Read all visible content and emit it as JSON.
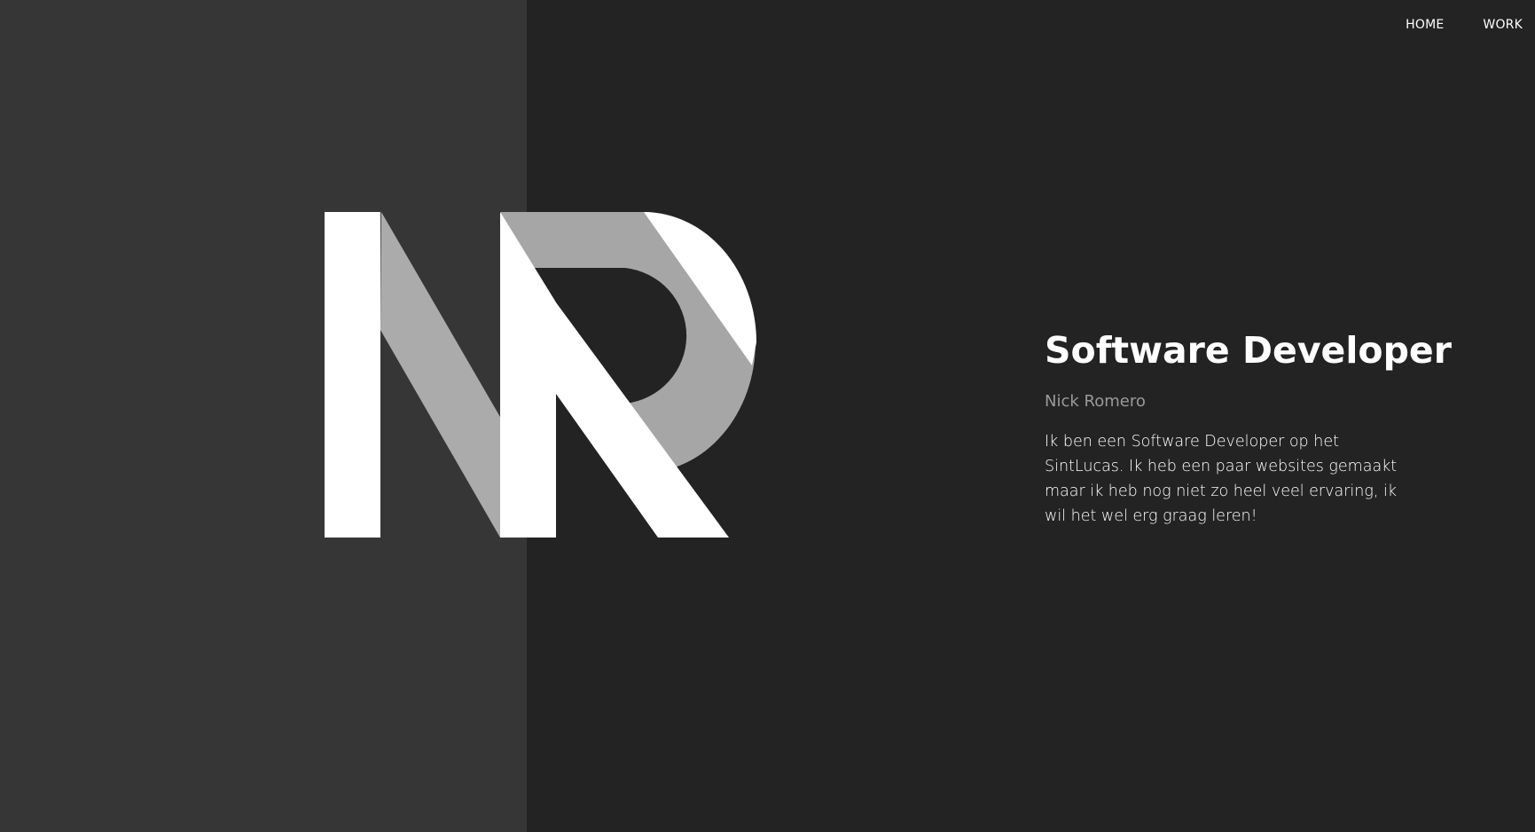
{
  "nav": {
    "items": [
      {
        "label": "HOME"
      },
      {
        "label": "WORK"
      }
    ]
  },
  "hero": {
    "title": "Software Developer",
    "name": "Nick Romero",
    "bio": "Ik ben een Software Developer op het SintLucas. Ik heb een paar websites gemaakt maar ik heb nog niet zo heel veel ervaring, ik wil het wel erg graag leren!"
  },
  "logo": {
    "icon": "nr-monogram-logo",
    "letters": "NR"
  },
  "colors": {
    "background": "#232323",
    "left_panel": "#363636",
    "logo_primary": "#ffffff",
    "logo_secondary": "#a6a6a6",
    "accent_muted": "#9a9a9a"
  }
}
